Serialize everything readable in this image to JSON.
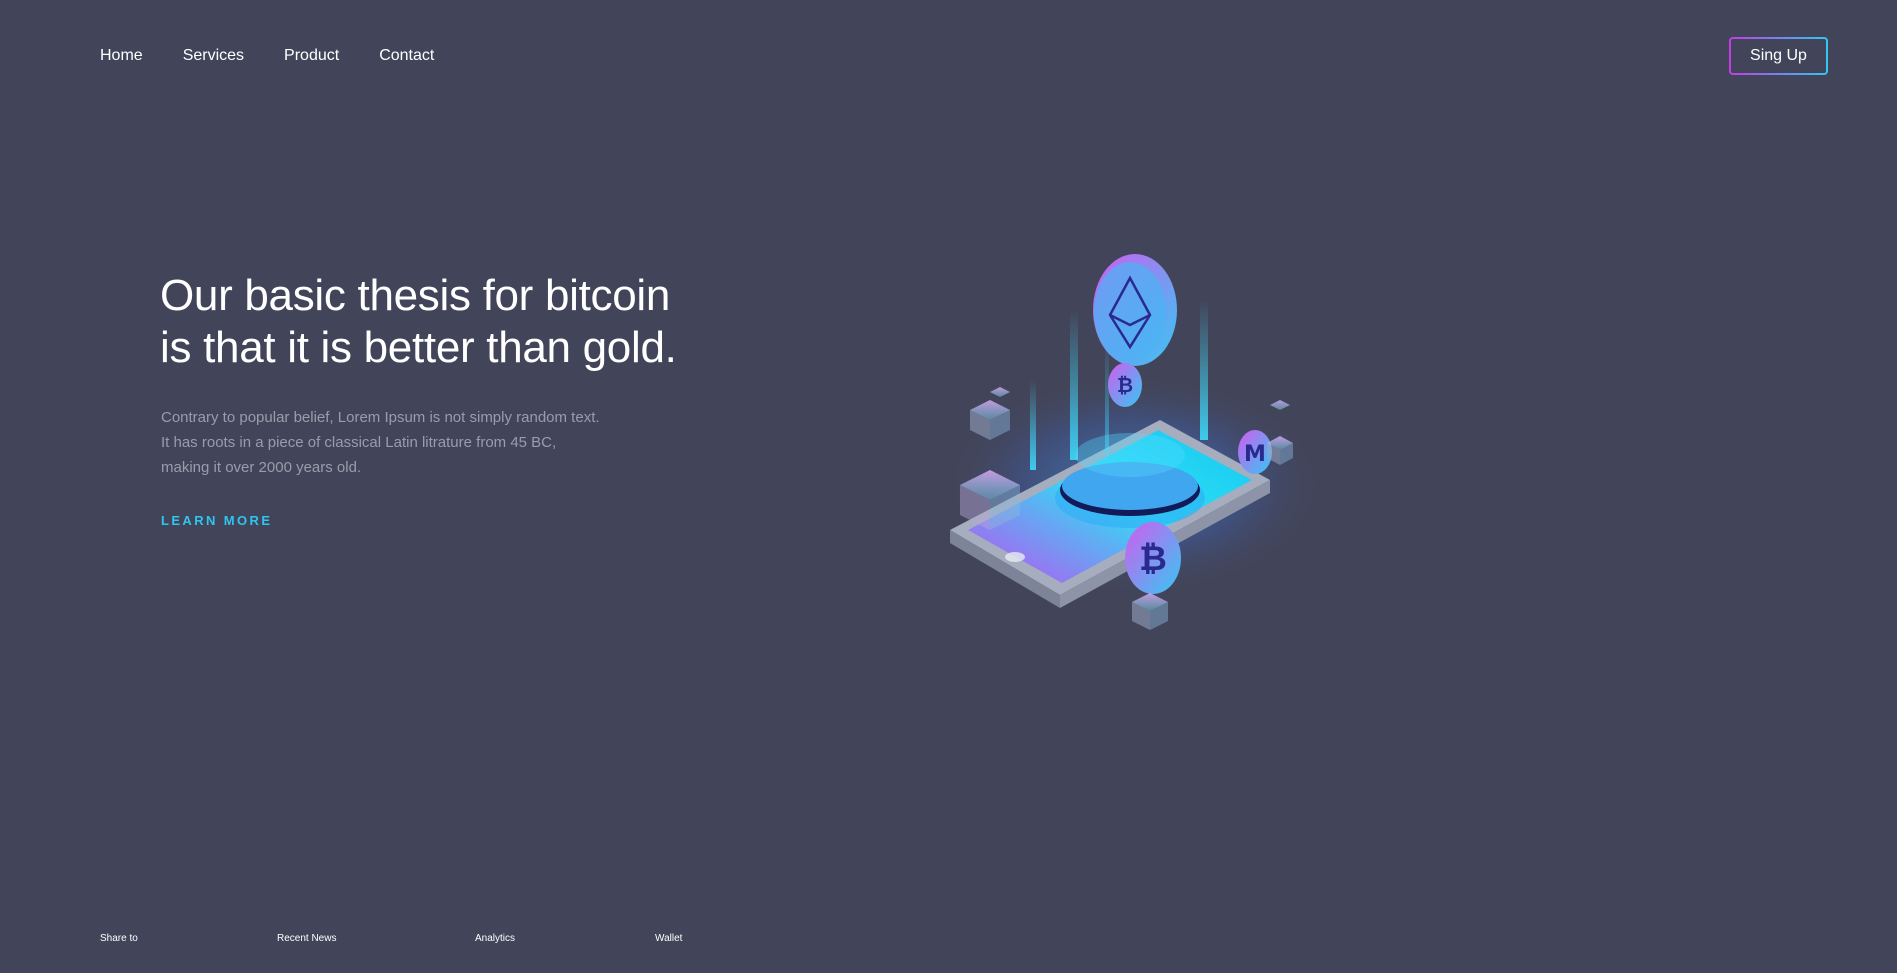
{
  "nav": {
    "items": [
      {
        "label": "Home"
      },
      {
        "label": "Services"
      },
      {
        "label": "Product"
      },
      {
        "label": "Contact"
      }
    ],
    "signup_label": "Sing Up"
  },
  "hero": {
    "title_line1": "Our basic thesis for bitcoin",
    "title_line2": "is that it is better than gold.",
    "description": "Contrary to popular belief, Lorem Ipsum is not simply random text. It has roots in a piece of classical Latin litrature from 45 BC, making it over 2000 years old.",
    "cta_label": "LEARN MORE"
  },
  "footer": {
    "links": [
      {
        "label": "Share to"
      },
      {
        "label": "Recent News"
      },
      {
        "label": "Analytics"
      },
      {
        "label": "Wallet"
      }
    ]
  },
  "colors": {
    "background": "#42455a",
    "accent_cyan": "#2ec5ee",
    "accent_magenta": "#c33ce8",
    "muted_text": "#9a9cab"
  },
  "illustration": {
    "icons": [
      "ethereum-icon",
      "bitcoin-icon",
      "monero-icon"
    ]
  }
}
